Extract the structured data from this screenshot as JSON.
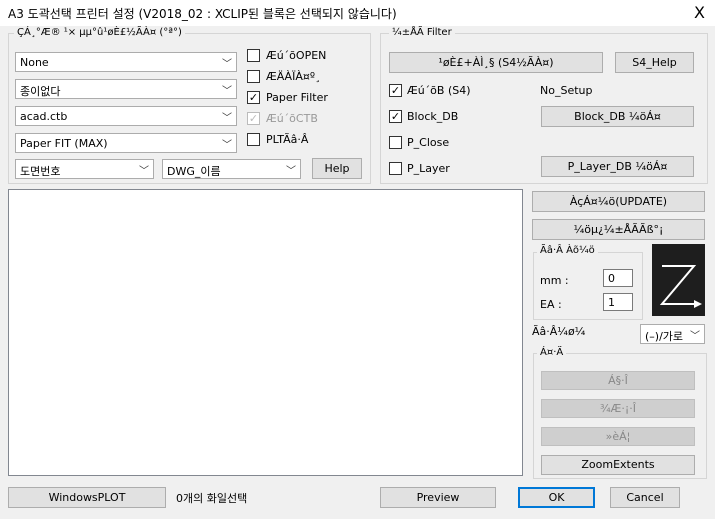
{
  "window": {
    "title": "A3 도곽선택 프린터 설정 (V2018_02 : XCLIP된 블록은 선택되지 않습니다)",
    "close_glyph": "X"
  },
  "printer_group": {
    "label": "ÇÁ¸°Æ® ¹× µµ°û¹øÈ£½ÃÀ¤ (°ª°)",
    "combos": [
      "None",
      "종이없다",
      "acad.ctb",
      "Paper FIT (MAX)"
    ],
    "combo_left": "도면번호",
    "combo_right": "DWG_이름",
    "help_label": "Help",
    "checks": [
      {
        "label": "Æú´õOPEN",
        "checked": false,
        "disabled": false
      },
      {
        "label": "ÆÄÀÏÀ¤º¸",
        "checked": false,
        "disabled": false
      },
      {
        "label": "Paper Filter",
        "checked": true,
        "disabled": false
      },
      {
        "label": "Æú´õCTB",
        "checked": true,
        "disabled": true
      },
      {
        "label": "PLTÃâ·Â",
        "checked": false,
        "disabled": false
      }
    ]
  },
  "filter_group": {
    "label": "¼±ÅÃ Filter",
    "top_button": "¹øÈ£+ÀÌ¸§ (S4½ÃÀ¤)",
    "s4_help": "S4_Help",
    "checks": [
      {
        "label": "Æú´õB (S4)",
        "checked": true
      },
      {
        "label": "Block_DB",
        "checked": true
      },
      {
        "label": "P_Close",
        "checked": false
      },
      {
        "label": "P_Layer",
        "checked": false
      }
    ],
    "no_setup": "No_Setup",
    "block_db_btn": "Block_DB ¼öÁ¤",
    "player_db_btn": "P_Layer_DB ¼öÁ¤"
  },
  "right_panel": {
    "update_btn": "ÀçÁ¤¼ö(UPDATE)",
    "select_btn": "¼öµ¿¼±ÅÃÃß°¡",
    "copy_group": "Ãâ·Â Àõ¼ö",
    "mm_label": "mm :",
    "mm_value": "0",
    "ea_label": "EA :",
    "ea_value": "1",
    "direction_label": "Ãâ·Â¼ø¼­",
    "direction_value": "(–)/가로",
    "view_group": "Á¤·Ä",
    "view_btns": [
      "Á§·Î",
      "¾Æ·¡·Î",
      "»èÁ¦"
    ],
    "zoom_btn": "ZoomExtents"
  },
  "bottom": {
    "windows_plot": "WindowsPLOT",
    "status": "0개의 화일선택",
    "preview": "Preview",
    "ok": "OK",
    "cancel": "Cancel"
  }
}
